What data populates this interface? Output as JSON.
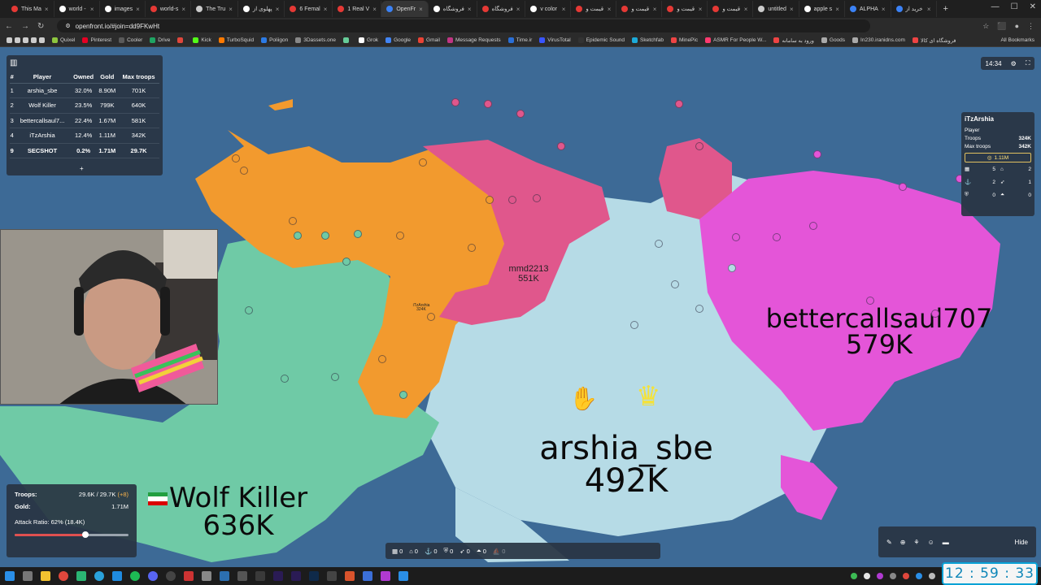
{
  "browser": {
    "tabs": [
      {
        "label": "This Ma",
        "color": "#e53935"
      },
      {
        "label": "world -",
        "color": "#ffffff"
      },
      {
        "label": "images",
        "color": "#ffffff"
      },
      {
        "label": "world-s",
        "color": "#e53935"
      },
      {
        "label": "The Tru",
        "color": "#cccccc"
      },
      {
        "label": "پهلوی از",
        "color": "#ffffff"
      },
      {
        "label": "6 Femal",
        "color": "#e53935"
      },
      {
        "label": "1 Real V",
        "color": "#e53935"
      },
      {
        "label": "OpenFr",
        "color": "#3b82f6"
      },
      {
        "label": "فروشگاه",
        "color": "#ffffff"
      },
      {
        "label": "فروشگاه",
        "color": "#e53935"
      },
      {
        "label": "v color",
        "color": "#ffffff"
      },
      {
        "label": "قیمت و",
        "color": "#e53935"
      },
      {
        "label": "قیمت و",
        "color": "#e53935"
      },
      {
        "label": "قیمت و",
        "color": "#e53935"
      },
      {
        "label": "قیمت و",
        "color": "#e53935"
      },
      {
        "label": "untitled",
        "color": "#cccccc"
      },
      {
        "label": "apple s",
        "color": "#ffffff"
      },
      {
        "label": "ALPHA",
        "color": "#3b82f6"
      },
      {
        "label": "خرید از",
        "color": "#3b82f6"
      }
    ],
    "url": "openfront.io/#join=dd9FKwHt",
    "bookmarks": [
      "Quixel",
      "Pinterest",
      "Cooler",
      "Drive",
      "",
      "Kick",
      "TurboSquid",
      "Poliigon",
      "3Dassets.one",
      "",
      "Grok",
      "Google",
      "Gmail",
      "Message Requests",
      "Time.ir",
      "VirusTotal",
      "Epidemic Sound",
      "Sketchfab",
      "MinePic",
      "ASMR For People W...",
      "ورود به سامانه",
      "Goods",
      "In230.iranidns.com",
      "فروشگاه ای کالا"
    ],
    "all_bookmarks": "All Bookmarks"
  },
  "leaderboard": {
    "headers": [
      "#",
      "Player",
      "Owned",
      "Gold",
      "Max troops"
    ],
    "rows": [
      {
        "rank": "1",
        "player": "arshia_sbe",
        "owned": "32.0%",
        "gold": "8.90M",
        "max": "701K"
      },
      {
        "rank": "2",
        "player": "Wolf Killer",
        "owned": "23.5%",
        "gold": "799K",
        "max": "640K"
      },
      {
        "rank": "3",
        "player": "bettercallsaul7...",
        "owned": "22.4%",
        "gold": "1.67M",
        "max": "581K"
      },
      {
        "rank": "4",
        "player": "iTzArshia",
        "owned": "12.4%",
        "gold": "1.11M",
        "max": "342K"
      },
      {
        "rank": "9",
        "player": "SECSHOT",
        "owned": "0.2%",
        "gold": "1.71M",
        "max": "29.7K"
      }
    ],
    "expand": "+"
  },
  "top_right": {
    "time": "14:34"
  },
  "player_info": {
    "name": "iTzArshia",
    "type": "Player",
    "troops_label": "Troops",
    "troops": "324K",
    "max_label": "Max troops",
    "max": "342K",
    "gold": "1.11M",
    "buildings": [
      {
        "icon": "city-icon",
        "count": "5"
      },
      {
        "icon": "factory-icon",
        "count": "2"
      },
      {
        "icon": "port-icon",
        "count": "2"
      },
      {
        "icon": "missile-icon",
        "count": "1"
      },
      {
        "icon": "defense-icon",
        "count": "0"
      },
      {
        "icon": "sam-icon",
        "count": "0"
      }
    ]
  },
  "map_labels": {
    "bettercallsaul": {
      "name": "bettercallsaul707",
      "troops": "579K"
    },
    "arshia": {
      "name": "arshia_sbe",
      "troops": "492K"
    },
    "wolf": {
      "name": "Wolf Killer",
      "troops": "636K"
    },
    "mmd": {
      "name": "mmd2213",
      "troops": "551K"
    },
    "itz": {
      "name": "iTzArshia",
      "troops": "324K"
    }
  },
  "troop_panel": {
    "troops_label": "Troops:",
    "troops_value": "29.6K / 29.7K",
    "troops_delta": "(+8)",
    "gold_label": "Gold:",
    "gold_value": "1.71M",
    "attack_ratio": "Attack Ratio: 62% (18.4K)",
    "attack_ratio_fraction": 0.62
  },
  "build_bar": {
    "items": [
      {
        "icon": "city-icon",
        "count": "0"
      },
      {
        "icon": "factory-icon",
        "count": "0"
      },
      {
        "icon": "port-icon",
        "count": "0"
      },
      {
        "icon": "defense-icon",
        "count": "0"
      },
      {
        "icon": "missile-icon",
        "count": "0"
      },
      {
        "icon": "sam-icon",
        "count": "0"
      },
      {
        "icon": "warship-icon",
        "count": "0"
      }
    ]
  },
  "chat_bar": {
    "hide": "Hide"
  },
  "clock": "12 : 59 : 33",
  "colors": {
    "ocean": "#3d6a96",
    "orange_territory": "#f29a2e",
    "pink_territory": "#e0578c",
    "magenta_territory": "#e455d8",
    "green_territory": "#6fcaa6",
    "lightblue_territory": "#b6dbe6"
  }
}
